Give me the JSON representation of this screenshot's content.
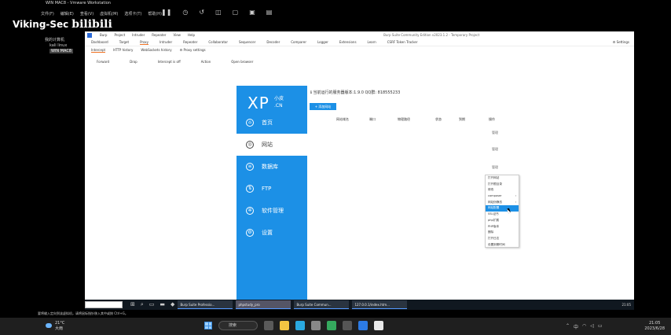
{
  "vm": {
    "title": "WIN MAC8 - Vmware Workstation",
    "menus": [
      "文件(F)",
      "编辑(E)",
      "查看(V)",
      "虚拟机(M)",
      "选项卡(T)",
      "帮助(H)"
    ],
    "library": [
      "我的计算机",
      "kali linux",
      "WIN MAC8"
    ]
  },
  "watermark": {
    "text": "Viking-Sec",
    "bili": "bilibili"
  },
  "burp": {
    "menus": [
      "Burp",
      "Project",
      "Intruder",
      "Repeater",
      "View",
      "Help"
    ],
    "window_title": "Burp Suite Community Edition v2023.1.2 - Temporary Project",
    "tabs": [
      "Dashboard",
      "Target",
      "Proxy",
      "Intruder",
      "Repeater",
      "Collaborator",
      "Sequencer",
      "Decoder",
      "Comparer",
      "Logger",
      "Extensions",
      "Learn",
      "CSRF Token Tracker"
    ],
    "settings": "Settings",
    "subtabs": [
      "Intercept",
      "HTTP history",
      "WebSockets history",
      "Proxy settings"
    ],
    "actions": [
      "Forward",
      "Drop",
      "Intercept is off",
      "Action",
      "Open browser"
    ]
  },
  "app": {
    "logo": "XP",
    "logo_sub": "小皮",
    "logo_sub2": ".CN",
    "header": "当前运行的服务器版本:1.9.0 QQ群: 818555233",
    "add_button": "+ 添加网站",
    "nav": [
      {
        "label": "首页",
        "icon": "home-icon"
      },
      {
        "label": "网站",
        "icon": "globe-icon"
      },
      {
        "label": "数据库",
        "icon": "database-icon"
      },
      {
        "label": "FTP",
        "icon": "ftp-icon"
      },
      {
        "label": "软件管理",
        "icon": "settings-icon"
      },
      {
        "label": "设置",
        "icon": "gear-icon"
      }
    ],
    "columns": [
      "网站域名",
      "端口",
      "物理路径",
      "状态",
      "到期",
      "操作"
    ],
    "row_ops": [
      "管理",
      "管理",
      "管理"
    ],
    "context_menu": [
      "打开网站",
      "打开根目录",
      "修改",
      "composer",
      "网站伪静态",
      "网站配置",
      "SSL证书",
      "php扩展",
      "PHP版本",
      "删除",
      "打开日志",
      "设置到期时间"
    ],
    "context_menu_selected": "网站伪静态"
  },
  "guest_taskbar": {
    "tasks": [
      "Burp Suite Professio...",
      "phpstudy_pro",
      "Burp Suite Commun...",
      "127.0.0.1/index.htm..."
    ],
    "clock": "21:05"
  },
  "hint": "要将输入定向到该虚拟机，请将鼠标指针移入其中或按 Ctrl+G。",
  "host_taskbar": {
    "weather_temp": "21°C",
    "weather_desc": "大雨",
    "search": "搜索",
    "clock_time": "21:05",
    "clock_date": "2023/6/28"
  }
}
